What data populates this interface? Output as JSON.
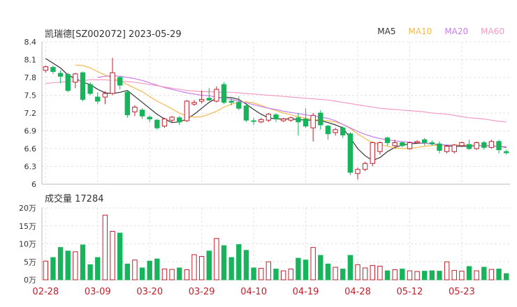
{
  "title": "凯瑞德[SZ002072] 2023-05-29",
  "legend": [
    {
      "name": "MA5",
      "color": "#333333"
    },
    {
      "name": "MA10",
      "color": "#f5b94a"
    },
    {
      "name": "MA20",
      "color": "#c77ee8"
    },
    {
      "name": "MA60",
      "color": "#f49ac5"
    }
  ],
  "volume_title": "成交量 17284",
  "colors": {
    "up": "#c21e2a",
    "down": "#17b45c",
    "grid": "#e3e3e3",
    "axis_text": "#333333",
    "date_text": "#c21e2a"
  },
  "chart_data": [
    {
      "type": "candlestick",
      "title": "凯瑞德[SZ002072] 2023-05-29",
      "ylim": [
        6,
        8.4
      ],
      "yticks": [
        "8.4",
        "8.1",
        "7.8",
        "7.5",
        "7.2",
        "6.9",
        "6.6",
        "6.3",
        "6"
      ],
      "x_ticks": [
        "02-28",
        "03-09",
        "03-20",
        "03-29",
        "04-10",
        "04-19",
        "04-28",
        "05-12",
        "05-23"
      ],
      "x_tick_index": [
        0,
        7,
        14,
        21,
        28,
        35,
        42,
        49,
        56
      ],
      "ohlc": [
        [
          7.92,
          7.98,
          7.88,
          8.0
        ],
        [
          7.97,
          7.9,
          7.86,
          8.0
        ],
        [
          7.87,
          7.82,
          7.7,
          7.92
        ],
        [
          7.85,
          7.58,
          7.55,
          7.88
        ],
        [
          7.72,
          7.86,
          7.62,
          7.88
        ],
        [
          7.88,
          7.43,
          7.4,
          7.9
        ],
        [
          7.68,
          7.53,
          7.5,
          7.72
        ],
        [
          7.47,
          7.4,
          7.35,
          7.55
        ],
        [
          7.47,
          7.53,
          7.35,
          7.57
        ],
        [
          7.53,
          7.88,
          7.5,
          8.13
        ],
        [
          7.8,
          7.67,
          7.6,
          7.82
        ],
        [
          7.55,
          7.17,
          7.12,
          7.58
        ],
        [
          7.22,
          7.3,
          7.15,
          7.33
        ],
        [
          7.25,
          7.15,
          7.1,
          7.28
        ],
        [
          7.13,
          7.1,
          7.05,
          7.16
        ],
        [
          7.08,
          6.95,
          6.92,
          7.1
        ],
        [
          6.98,
          7.1,
          6.95,
          7.12
        ],
        [
          7.08,
          7.13,
          7.05,
          7.15
        ],
        [
          7.12,
          7.05,
          7.0,
          7.15
        ],
        [
          7.07,
          7.4,
          7.05,
          7.42
        ],
        [
          7.35,
          7.38,
          7.32,
          7.42
        ],
        [
          7.4,
          7.43,
          7.36,
          7.58
        ],
        [
          7.45,
          7.42,
          7.4,
          7.62
        ],
        [
          7.4,
          7.6,
          7.38,
          7.65
        ],
        [
          7.68,
          7.38,
          7.35,
          7.72
        ],
        [
          7.4,
          7.38,
          7.33,
          7.45
        ],
        [
          7.38,
          7.28,
          7.25,
          7.48
        ],
        [
          7.32,
          7.08,
          7.05,
          7.35
        ],
        [
          7.07,
          7.06,
          7.0,
          7.12
        ],
        [
          7.05,
          7.09,
          7.03,
          7.12
        ],
        [
          7.08,
          7.18,
          7.05,
          7.2
        ],
        [
          7.17,
          7.1,
          7.05,
          7.2
        ],
        [
          7.07,
          7.1,
          7.05,
          7.12
        ],
        [
          7.08,
          7.12,
          7.05,
          7.14
        ],
        [
          7.12,
          7.05,
          6.82,
          7.2
        ],
        [
          7.1,
          6.98,
          6.95,
          7.28
        ],
        [
          6.95,
          7.16,
          6.72,
          7.2
        ],
        [
          7.2,
          7.0,
          6.92,
          7.25
        ],
        [
          6.98,
          6.85,
          6.75,
          7.0
        ],
        [
          6.87,
          6.92,
          6.82,
          6.95
        ],
        [
          6.95,
          6.83,
          6.78,
          6.98
        ],
        [
          6.85,
          6.2,
          6.15,
          6.88
        ],
        [
          6.18,
          6.25,
          6.08,
          6.28
        ],
        [
          6.25,
          6.35,
          6.22,
          6.38
        ],
        [
          6.35,
          6.7,
          6.3,
          6.72
        ],
        [
          6.55,
          6.7,
          6.5,
          6.72
        ],
        [
          6.78,
          6.7,
          6.65,
          6.8
        ],
        [
          6.65,
          6.7,
          6.6,
          6.75
        ],
        [
          6.7,
          6.65,
          6.62,
          6.72
        ],
        [
          6.6,
          6.7,
          6.58,
          6.72
        ],
        [
          6.7,
          6.72,
          6.68,
          6.74
        ],
        [
          6.75,
          6.7,
          6.65,
          6.78
        ],
        [
          6.7,
          6.68,
          6.65,
          6.74
        ],
        [
          6.68,
          6.57,
          6.52,
          6.72
        ],
        [
          6.55,
          6.64,
          6.52,
          6.66
        ],
        [
          6.55,
          6.66,
          6.52,
          6.68
        ],
        [
          6.65,
          6.7,
          6.63,
          6.72
        ],
        [
          6.67,
          6.6,
          6.58,
          6.75
        ],
        [
          6.6,
          6.7,
          6.58,
          6.72
        ],
        [
          6.7,
          6.62,
          6.58,
          6.73
        ],
        [
          6.62,
          6.72,
          6.6,
          6.75
        ],
        [
          6.72,
          6.58,
          6.52,
          6.75
        ],
        [
          6.55,
          6.53,
          6.5,
          6.58
        ]
      ],
      "ma": {
        "MA5": [
          8.12,
          8.04,
          7.96,
          7.84,
          7.78,
          7.72,
          7.68,
          7.6,
          7.54,
          7.53,
          7.55,
          7.58,
          7.48,
          7.38,
          7.28,
          7.18,
          7.1,
          7.04,
          7.05,
          7.1,
          7.18,
          7.28,
          7.38,
          7.45,
          7.47,
          7.46,
          7.43,
          7.35,
          7.26,
          7.18,
          7.12,
          7.1,
          7.1,
          7.1,
          7.09,
          7.08,
          7.08,
          7.07,
          7.04,
          7.0,
          6.95,
          6.78,
          6.6,
          6.48,
          6.4,
          6.45,
          6.55,
          6.62,
          6.66,
          6.68,
          6.69,
          6.69,
          6.68,
          6.67,
          6.65,
          6.64,
          6.64,
          6.64,
          6.65,
          6.65,
          6.65,
          6.64,
          6.62
        ],
        "MA10": [
          null,
          null,
          null,
          null,
          8.01,
          8.0,
          7.96,
          7.9,
          7.84,
          7.79,
          7.74,
          7.68,
          7.62,
          7.56,
          7.48,
          7.4,
          7.34,
          7.27,
          7.2,
          7.15,
          7.13,
          7.14,
          7.18,
          7.23,
          7.3,
          7.35,
          7.38,
          7.39,
          7.37,
          7.33,
          7.28,
          7.24,
          7.2,
          7.17,
          7.14,
          7.11,
          7.09,
          7.08,
          7.07,
          7.05,
          7.01,
          6.94,
          6.85,
          6.77,
          6.7,
          6.67,
          6.64,
          6.61,
          6.6,
          6.6,
          6.62,
          6.64,
          6.65,
          6.66,
          6.66,
          6.66,
          6.66,
          6.66,
          6.66,
          6.65,
          6.65,
          6.64,
          6.63
        ],
        "MA20": [
          null,
          null,
          null,
          null,
          null,
          null,
          null,
          7.8,
          7.82,
          7.83,
          7.82,
          7.8,
          7.78,
          7.75,
          7.71,
          7.67,
          7.63,
          7.6,
          7.57,
          7.54,
          7.52,
          7.5,
          7.49,
          7.47,
          7.45,
          7.43,
          7.4,
          7.37,
          7.34,
          7.31,
          7.28,
          7.26,
          7.23,
          7.21,
          7.19,
          7.17,
          7.15,
          7.13,
          7.11,
          7.07,
          7.01,
          6.95,
          6.89,
          6.84,
          6.8,
          6.77,
          6.75,
          6.73,
          6.72,
          6.71,
          6.7,
          6.69,
          6.68,
          6.67,
          6.66,
          6.65,
          6.65,
          6.65,
          6.65,
          6.65,
          6.64,
          6.64,
          6.63
        ],
        "MA60": [
          7.7,
          7.71,
          7.72,
          7.73,
          7.74,
          7.75,
          7.76,
          7.76,
          7.76,
          7.75,
          7.74,
          7.73,
          7.72,
          7.7,
          7.68,
          7.66,
          7.64,
          7.62,
          7.6,
          7.58,
          7.57,
          7.56,
          7.56,
          7.55,
          7.55,
          7.55,
          7.54,
          7.53,
          7.52,
          7.51,
          7.5,
          7.49,
          7.48,
          7.47,
          7.46,
          7.45,
          7.44,
          7.43,
          7.42,
          7.4,
          7.38,
          7.36,
          7.34,
          7.32,
          7.3,
          7.28,
          7.27,
          7.26,
          7.25,
          7.24,
          7.23,
          7.22,
          7.2,
          7.19,
          7.18,
          7.16,
          7.14,
          7.12,
          7.11,
          7.1,
          7.08,
          7.06,
          7.05
        ]
      }
    },
    {
      "type": "bar",
      "title": "成交量 17284",
      "ylim": [
        0,
        200000
      ],
      "yticks": [
        "20万",
        "15万",
        "10万",
        "5万",
        "0万"
      ],
      "values": [
        52000,
        62000,
        90000,
        80000,
        78000,
        97000,
        42000,
        62000,
        180000,
        135000,
        130000,
        44000,
        55000,
        33000,
        52000,
        58000,
        30000,
        29000,
        33000,
        28000,
        70000,
        65000,
        80000,
        115000,
        95000,
        62000,
        98000,
        82000,
        33000,
        32000,
        50000,
        30000,
        25000,
        30000,
        60000,
        55000,
        90000,
        68000,
        44000,
        35000,
        30000,
        68000,
        42000,
        33000,
        40000,
        38000,
        25000,
        28000,
        30000,
        25000,
        23000,
        24000,
        25000,
        24000,
        50000,
        26000,
        24000,
        37000,
        25000,
        35000,
        29000,
        30000,
        17284
      ]
    }
  ]
}
